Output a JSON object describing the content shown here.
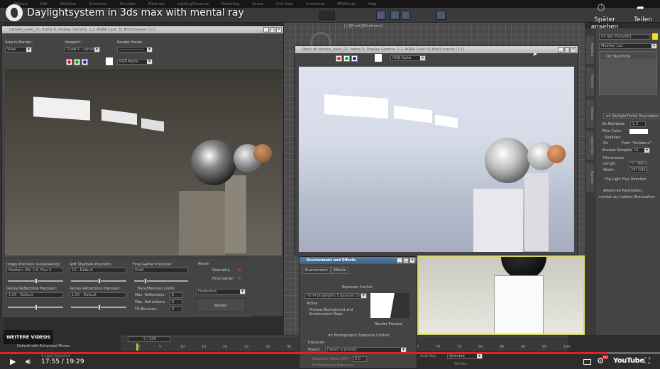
{
  "video": {
    "title": "Daylightsystem in 3ds max with mental ray",
    "watch_later": "Später ansehen",
    "share": "Teilen",
    "more_videos": "WEITERE VIDEOS",
    "current_time": "17:55",
    "duration": "19:29",
    "time_display": "17:55 / 19:29",
    "progress_percent": 92,
    "progress_color": "#e52222",
    "hd_badge": "HD",
    "brand": "YouTube"
  },
  "max": {
    "menu": [
      "Objects",
      "Edit",
      "Modifiers",
      "Animation",
      "Simulate",
      "Materials",
      "Lighting/Cameras",
      "Rendering",
      "Scene",
      "Civil View",
      "Customize",
      "MAXScript",
      "Help"
    ],
    "viewport_label": "[+][Front][Wireframe]",
    "render_window_1": {
      "title": "camera_nassi_01, frame 0, Display Gamma: 2.2, RGBA Color 32 Bits/Channel (1:1)",
      "area_label": "Area to Render:",
      "area_value": "View",
      "viewport_label": "Viewport:",
      "viewport_value": "Quad 4 - camera",
      "preset_label": "Render Preset:",
      "preset_value": "-------------------",
      "channel": "RGB Alpha",
      "image_precision_label": "Image Precision (Antialiasing):",
      "image_precision_value": "Medium: Min 1/4, Max 4",
      "soft_shadows_label": "Soft Shadows Precision:",
      "soft_shadows_value": "1X - Default",
      "final_gather_label": "Final Gather Precision:",
      "final_gather_value": "Draft",
      "glossy_refl_label": "Glossy Reflections Precision:",
      "glossy_refl_value": "1.0X - Default",
      "glossy_refr_label": "Glossy Refractions Precision:",
      "glossy_refr_value": "1.0X - Default",
      "trace_label": "Trace/Bounces Limits",
      "max_refl_label": "Max. Reflections:",
      "max_refl_value": "6",
      "max_refr_label": "Max. Refractions:",
      "max_refr_value": "6",
      "fg_bounces_label": "FG Bounces:",
      "fg_bounces_value": "0",
      "reuse_label": "Reuse",
      "geometry_label": "Geometry",
      "final_gather_reuse_label": "Final Gather",
      "mode_value": "Production",
      "render_button": "Render"
    },
    "render_window_2": {
      "title": "Omni of camera_nassi_01, frame 0, Display Gamma: 2.2, RGBA Color 32 Bits/Channel (1:1)",
      "channel": "RGB Alpha"
    },
    "env_dialog": {
      "title": "Environment and Effects",
      "tabs": [
        "Environment",
        "Effects"
      ],
      "exposure_header": "Exposure Control",
      "exposure_type": "mr Photographic Exposure Control",
      "active_label": "Active",
      "process_bg_label": "Process Background and Environment Maps",
      "render_preview": "Render Preview",
      "photo_header": "mr Photographic Exposure Control",
      "exposure_group": "Exposure",
      "preset_label": "Preset:",
      "preset_value": "[Select a preset]",
      "ev_label": "Exposure Value (EV):",
      "ev_value": "0.0",
      "photo_exposure": "Photographic Exposure"
    },
    "command_panel": {
      "object_name": "mr Sky Portal001",
      "object_color": "#f0e020",
      "modifier_list": "Modifier List",
      "stack_item": "mr Sky Portal",
      "params_header": "mr Skylight Portal Parameters",
      "on_multiplier_label": "On Multiplier:",
      "multiplier_value": "1.0",
      "filter_color_label": "Filter Color:",
      "shadows_label": "Shadows",
      "shadows_on": "On",
      "from_outdoors": "From \"Outdoors\"",
      "shadow_samples_label": "Shadow Samples:",
      "shadow_samples_value": "16",
      "dimensions_label": "Dimensions",
      "length_label": "Length:",
      "length_value": "57,368cm",
      "width_label": "Width:",
      "width_value": "297,582c",
      "flip_label": "Flip Light Flux Direction",
      "advanced": "Advanced Parameters",
      "indirect": "mental ray Indirect Illumination"
    },
    "side_tabs": [
      "Modeling",
      "Freeform",
      "Selection",
      "Object Paint",
      "Populate"
    ],
    "timeline": {
      "frame_display": "0 / 100",
      "ticks": [
        "0",
        "5",
        "10",
        "15",
        "20",
        "25",
        "30",
        "35",
        "40",
        "45",
        "50",
        "55",
        "60",
        "65",
        "70",
        "75",
        "80",
        "85",
        "90",
        "95",
        "100"
      ]
    },
    "status": {
      "selected": "1 Light Selected",
      "workspace": "Default with Enhanced Menus",
      "auto_key": "Auto Key",
      "selected_mode": "Selected",
      "set_key": "Set Key"
    }
  }
}
